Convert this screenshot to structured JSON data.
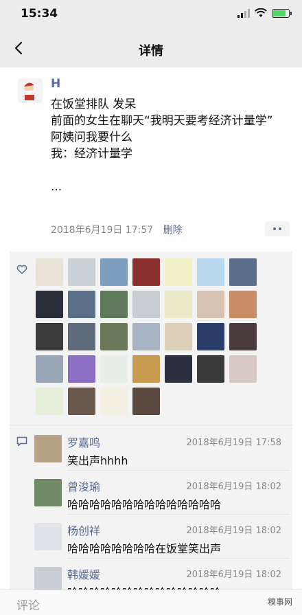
{
  "status_bar": {
    "time": "15:34"
  },
  "nav": {
    "title": "详情",
    "back_icon": "chevron-left-icon"
  },
  "post": {
    "author": "H",
    "content": "在饭堂排队 发呆\n前面的女生在聊天“我明天要考经济计量学”\n阿姨问我要什么\n我：经济计量学\n\n...",
    "timestamp": "2018年6月19日 17:57",
    "delete_label": "删除"
  },
  "likes": {
    "icon": "heart-icon",
    "avatar_colors": [
      "#e9e2d6",
      "#c9cfd6",
      "#7f9fc0",
      "#8a2e2e",
      "#f4f0c8",
      "#b9d9ef",
      "#5a6e8a",
      "#2a2f3a",
      "#5b6f88",
      "#5e7a5a",
      "#c8ccd3",
      "#eeeac8",
      "#d9c2b2",
      "#c98c66",
      "#3b3b3b",
      "#5d6b7a",
      "#6b7a5a",
      "#a9b5c4",
      "#dccfb8",
      "#2b3f6a",
      "#4a3b3e",
      "#98a6b5",
      "#8a6fc4",
      "#e8efe8",
      "#c69b4e",
      "#2c3140",
      "#3a3a3a",
      "#d7c9c4",
      "#e6efd8",
      "#6a5a4e",
      "#f3f0e2",
      "#5a4a40"
    ]
  },
  "comments": {
    "icon": "comment-icon",
    "items": [
      {
        "name": "罗嘉鸣",
        "time": "2018年6月19日 17:58",
        "text": "笑出声hhhh",
        "avatar_color": "#b8a389"
      },
      {
        "name": "曾浚瑜",
        "time": "2018年6月19日 18:02",
        "text": "哈哈哈哈哈哈哈哈哈哈哈哈哈哈",
        "avatar_color": "#6f8a64"
      },
      {
        "name": "杨创祥",
        "time": "2018年6月19日 18:02",
        "text": "哈哈哈哈哈哈哈哈在饭堂笑出声",
        "avatar_color": "#dfe3e8"
      },
      {
        "name": "韩媛媛",
        "time": "2018年6月19日 18:02",
        "text": "哈哈哈哈哈哈哈哈哈哈哈哈哈哈",
        "avatar_color": "#c9ced6"
      }
    ]
  },
  "input": {
    "placeholder": "评论",
    "watermark": "糗事网"
  }
}
